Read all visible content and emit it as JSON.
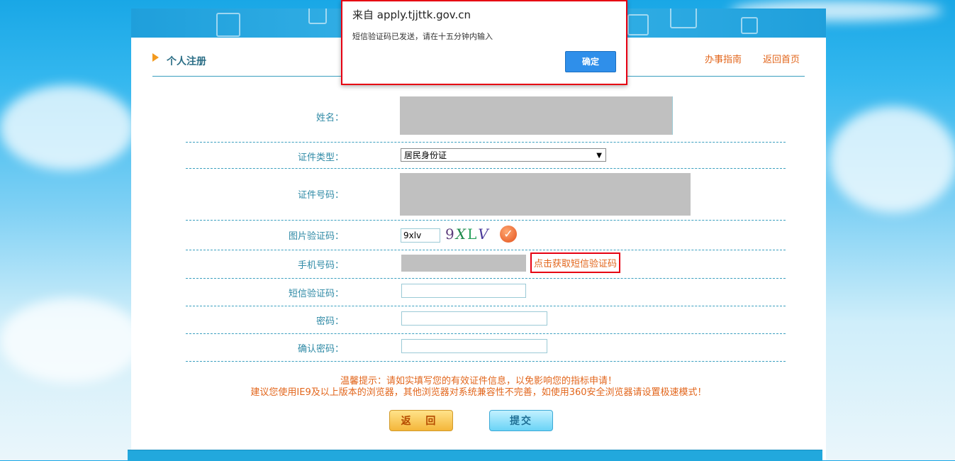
{
  "header": {
    "title": "个人注册",
    "nav_links": {
      "guide": "办事指南",
      "home": "返回首页"
    }
  },
  "form": {
    "name": {
      "label": "姓名："
    },
    "id_type": {
      "label": "证件类型：",
      "selected": "居民身份证"
    },
    "id_number": {
      "label": "证件号码："
    },
    "captcha": {
      "label": "图片验证码：",
      "value": "9xlv",
      "image_text": "9XLV"
    },
    "phone": {
      "label": "手机号码：",
      "sms_link": "点击获取短信验证码"
    },
    "sms_code": {
      "label": "短信验证码：",
      "value": ""
    },
    "password": {
      "label": "密码：",
      "value": ""
    },
    "confirm_password": {
      "label": "确认密码：",
      "value": ""
    }
  },
  "tips": {
    "line1": "温馨提示：请如实填写您的有效证件信息，以免影响您的指标申请！",
    "line2": "建议您使用IE9及以上版本的浏览器，其他浏览器对系统兼容性不完善，如使用360安全浏览器请设置极速模式！"
  },
  "buttons": {
    "back": "返 回",
    "submit": "提交"
  },
  "dialog": {
    "title": "来自 apply.tjjttk.gov.cn",
    "message": "短信验证码已发送，请在十五分钟内输入",
    "ok": "确定"
  },
  "icons": {
    "title_arrow": "arrow-right-icon",
    "refresh": "refresh-check-icon",
    "select_arrow": "chevron-down-icon"
  },
  "colors": {
    "accent_orange": "#e2661c",
    "label_teal": "#2f8aa6",
    "highlight_red": "#e60012",
    "dialog_button": "#2f8fea"
  }
}
